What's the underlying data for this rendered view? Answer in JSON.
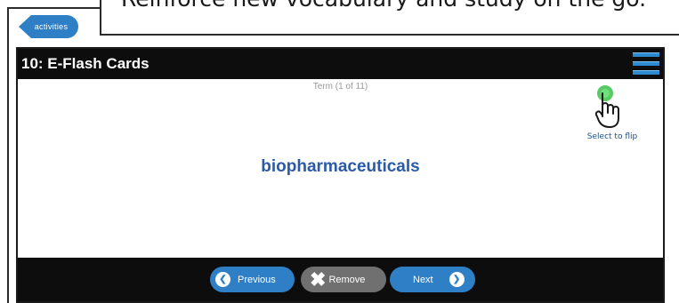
{
  "caption": "Reinforce new vocabulary and study on the go.",
  "activities_label": "activities",
  "header": {
    "title": "10: E-Flash Cards"
  },
  "card": {
    "term_label": "Term (1 of 11)",
    "term": "biopharmaceuticals",
    "flip_hint": "Select to flip"
  },
  "nav": {
    "previous": "Previous",
    "remove": "Remove",
    "next": "Next"
  },
  "colors": {
    "accent_blue": "#2f7fc6",
    "term_blue": "#2b5aa8",
    "bar_black": "#0d0d0d",
    "remove_gray": "#707070",
    "hint_green": "#3bbf4a"
  },
  "icons": [
    "menu-icon",
    "hand-pointer-icon",
    "chevron-left-icon",
    "close-icon",
    "chevron-right-icon"
  ]
}
